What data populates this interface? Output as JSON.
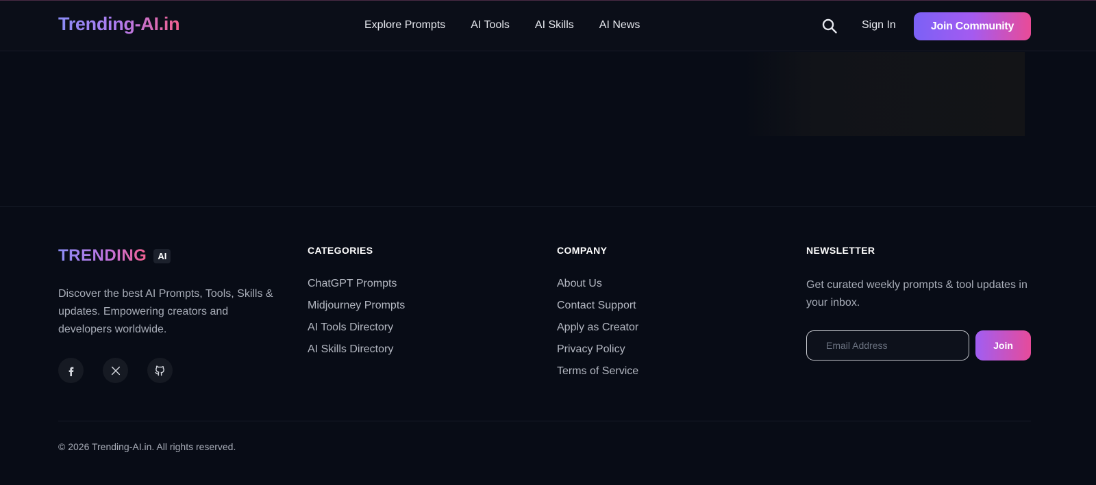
{
  "header": {
    "logo": "Trending-AI.in",
    "nav": [
      "Explore Prompts",
      "AI Tools",
      "AI Skills",
      "AI News"
    ],
    "sign_in": "Sign In",
    "cta": "Join Community",
    "search_icon": "search-icon"
  },
  "footer": {
    "brand": {
      "name": "TRENDING",
      "badge": "AI",
      "description": "Discover the best AI Prompts, Tools, Skills & updates. Empowering creators and developers worldwide."
    },
    "socials": [
      "facebook-icon",
      "x-icon",
      "github-icon"
    ],
    "categories": {
      "title": "CATEGORIES",
      "links": [
        "ChatGPT Prompts",
        "Midjourney Prompts",
        "AI Tools Directory",
        "AI Skills Directory"
      ]
    },
    "company": {
      "title": "COMPANY",
      "links": [
        "About Us",
        "Contact Support",
        "Apply as Creator",
        "Privacy Policy",
        "Terms of Service"
      ]
    },
    "newsletter": {
      "title": "NEWSLETTER",
      "text": "Get curated weekly prompts & tool updates in your inbox.",
      "email_placeholder": "Email Address",
      "email_value": "",
      "button": "Join"
    },
    "copyright": "© 2026 Trending-AI.in. All rights reserved."
  },
  "colors": {
    "background": "#080c16",
    "accent_start": "#7b61f6",
    "accent_end": "#e94b97"
  }
}
